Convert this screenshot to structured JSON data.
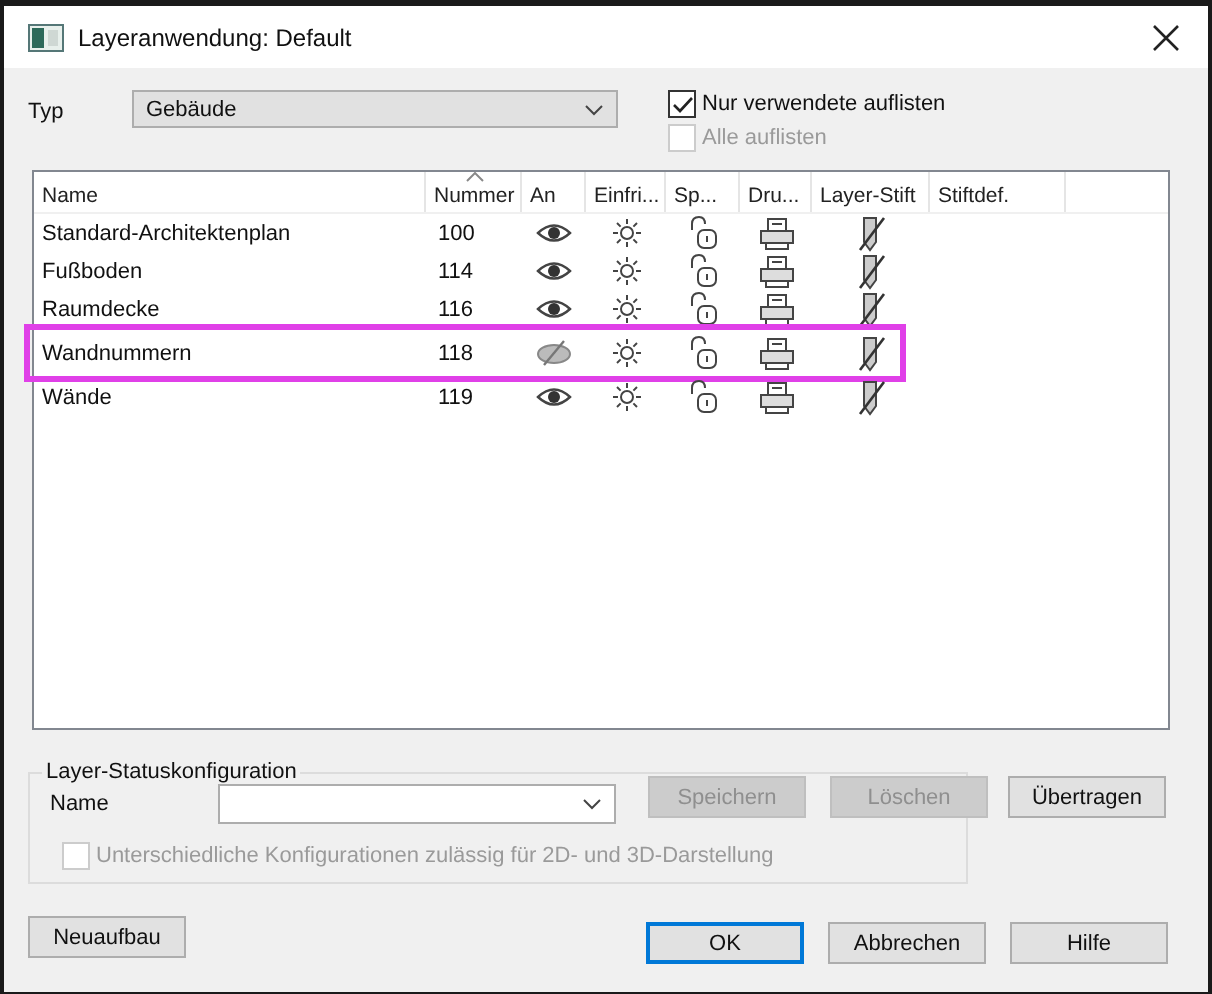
{
  "window": {
    "title": "Layeranwendung: Default"
  },
  "typ": {
    "label": "Typ",
    "value": "Gebäude"
  },
  "options": [
    {
      "label": "Nur verwendete auflisten",
      "checked": true,
      "disabled": false
    },
    {
      "label": "Alle auflisten",
      "checked": false,
      "disabled": true
    }
  ],
  "table": {
    "columns": [
      {
        "label": "Name",
        "sorted": false
      },
      {
        "label": "Nummer",
        "sorted": true
      },
      {
        "label": "An",
        "sorted": false
      },
      {
        "label": "Einfri...",
        "sorted": false
      },
      {
        "label": "Sp...",
        "sorted": false
      },
      {
        "label": "Dru...",
        "sorted": false
      },
      {
        "label": "Layer-Stift",
        "sorted": false
      },
      {
        "label": "Stiftdef.",
        "sorted": false
      }
    ],
    "rows": [
      {
        "name": "Standard-Architektenplan",
        "number": "100",
        "visible": true,
        "highlighted": false
      },
      {
        "name": "Fußboden",
        "number": "114",
        "visible": true,
        "highlighted": false
      },
      {
        "name": "Raumdecke",
        "number": "116",
        "visible": true,
        "highlighted": false
      },
      {
        "name": "Wandnummern",
        "number": "118",
        "visible": false,
        "highlighted": true
      },
      {
        "name": "Wände",
        "number": "119",
        "visible": true,
        "highlighted": false
      }
    ]
  },
  "status_config": {
    "title": "Layer-Statuskonfiguration",
    "name_label": "Name",
    "buttons": [
      {
        "label": "Speichern",
        "disabled": true
      },
      {
        "label": "Löschen",
        "disabled": true
      },
      {
        "label": "Übertragen",
        "disabled": false
      }
    ],
    "checkbox": {
      "label": "Unterschiedliche Konfigurationen zulässig für 2D- und 3D-Darstellung",
      "checked": false,
      "disabled": true
    }
  },
  "footer_buttons": [
    {
      "label": "Neuaufbau",
      "default": false
    },
    {
      "label": "OK",
      "default": true
    },
    {
      "label": "Abbrechen",
      "default": false
    },
    {
      "label": "Hilfe",
      "default": false
    }
  ]
}
